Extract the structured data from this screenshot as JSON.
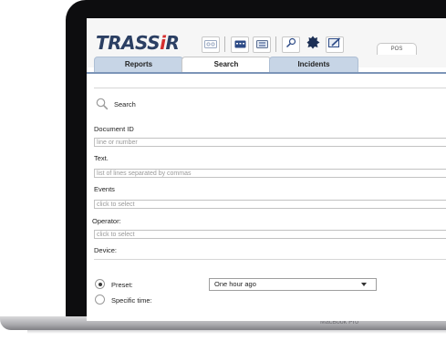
{
  "app": {
    "logo_part1": "TRASS",
    "logo_part2": "i",
    "logo_part3": "R",
    "logo_text": "TRASSiR",
    "brand_colors": {
      "navy": "#2b3f63",
      "red": "#d52d2d"
    },
    "pos_tab": "POS"
  },
  "toolbar": {
    "icons": [
      "cassette-icon",
      "keyboard-icon",
      "list-icon",
      "magnifier-icon",
      "puzzle-icon",
      "edit-window-icon"
    ]
  },
  "tabs": [
    {
      "label": "Reports",
      "active": false
    },
    {
      "label": "Search",
      "active": true
    },
    {
      "label": "Incidents",
      "active": false
    }
  ],
  "search": {
    "title": "Search",
    "document_id": {
      "label": "Document ID",
      "placeholder": "line or number"
    },
    "text": {
      "label": "Text.",
      "placeholder": "list of lines separated by commas"
    },
    "events": {
      "label": "Events",
      "placeholder": "click to select"
    },
    "operator": {
      "label": "Operator:",
      "placeholder": "click to select"
    },
    "device": {
      "label": "Device:"
    },
    "time": {
      "preset_label": "Preset:",
      "preset_selected": true,
      "preset_value": "One hour ago",
      "specific_label": "Specific time:",
      "specific_selected": false
    }
  },
  "device_label": "MacBook Pro"
}
